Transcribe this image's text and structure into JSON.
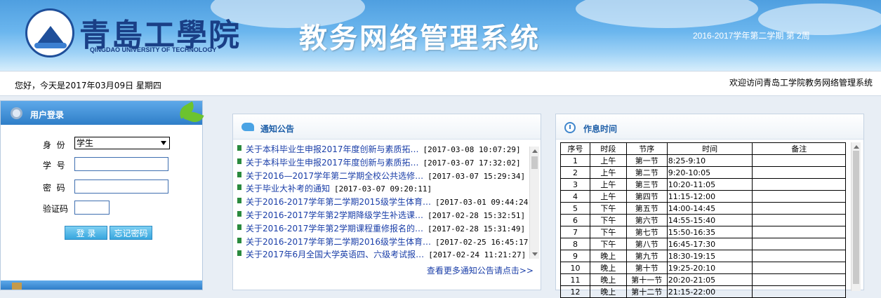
{
  "header": {
    "school_name": "青島工學院",
    "school_name_en": "QINGDAO UNIVERSITY OF TECHNOLOGY",
    "system_title": "教务网络管理系统",
    "term": "2016-2017学年第二学期 第 2周"
  },
  "bar": {
    "greeting": "您好，今天是2017年03月09日 星期四",
    "welcome": "欢迎访问青岛工学院教务网络管理系统"
  },
  "login": {
    "title": "用户登录",
    "identity_label": "身  份",
    "identity_value": "学生",
    "student_id_label": "学  号",
    "password_label": "密  码",
    "captcha_label": "验证码",
    "login_button": "登 录",
    "forgot_button": "忘记密码"
  },
  "notice": {
    "title": "通知公告",
    "items": [
      {
        "title": "关于本科毕业生申报2017年度创新与素质拓…",
        "date": "[2017-03-08 10:07:29]"
      },
      {
        "title": "关于本科毕业生申报2017年度创新与素质拓…",
        "date": "[2017-03-07 17:32:02]"
      },
      {
        "title": "关于2016—2017学年第二学期全校公共选修…",
        "date": "[2017-03-07 15:29:34]"
      },
      {
        "title": "关于毕业大补考的通知",
        "date": "[2017-03-07 09:20:11]"
      },
      {
        "title": "关于2016-2017学年第二学期2015级学生体育…",
        "date": "[2017-03-01 09:44:24]"
      },
      {
        "title": "关于2016-2017学年第2学期降级学生补选课…",
        "date": "[2017-02-28 15:32:51]"
      },
      {
        "title": "关于2016-2017学年第2学期课程重修报名的…",
        "date": "[2017-02-28 15:31:49]"
      },
      {
        "title": "关于2016-2017学年第二学期2016级学生体育…",
        "date": "[2017-02-25 16:45:17]"
      },
      {
        "title": "关于2017年6月全国大学英语四、六级考试报…",
        "date": "[2017-02-24 11:21:27]"
      }
    ],
    "more": "查看更多通知公告请点击>>"
  },
  "schedule": {
    "title": "作息时间",
    "headers": [
      "序号",
      "时段",
      "节序",
      "时间",
      "备注"
    ],
    "rows": [
      [
        "1",
        "上午",
        "第一节",
        "8:25-9:10",
        ""
      ],
      [
        "2",
        "上午",
        "第二节",
        "9:20-10:05",
        ""
      ],
      [
        "3",
        "上午",
        "第三节",
        "10:20-11:05",
        ""
      ],
      [
        "4",
        "上午",
        "第四节",
        "11:15-12:00",
        ""
      ],
      [
        "5",
        "下午",
        "第五节",
        "14:00-14:45",
        ""
      ],
      [
        "6",
        "下午",
        "第六节",
        "14:55-15:40",
        ""
      ],
      [
        "7",
        "下午",
        "第七节",
        "15:50-16:35",
        ""
      ],
      [
        "8",
        "下午",
        "第八节",
        "16:45-17:30",
        ""
      ],
      [
        "9",
        "晚上",
        "第九节",
        "18:30-19:15",
        ""
      ],
      [
        "10",
        "晚上",
        "第十节",
        "19:25-20:10",
        ""
      ],
      [
        "11",
        "晚上",
        "第十一节",
        "20:20-21:05",
        ""
      ],
      [
        "12",
        "晚上",
        "第十二节",
        "21:15-22:00",
        ""
      ]
    ]
  }
}
